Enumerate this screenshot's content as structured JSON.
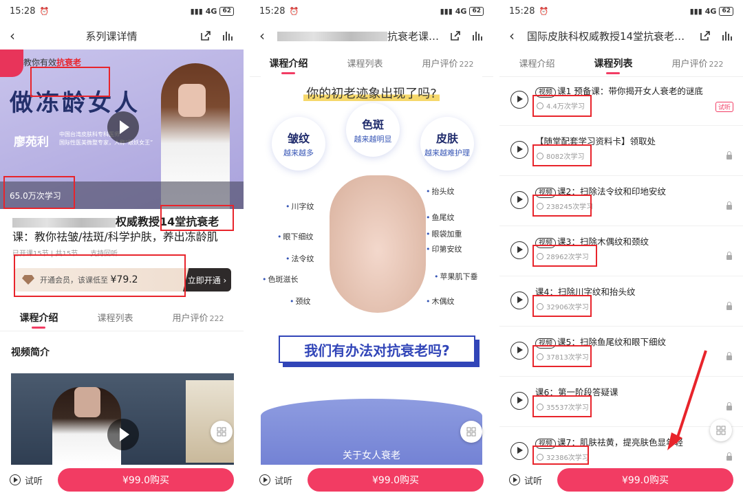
{
  "status": {
    "time": "15:28",
    "network": "4G",
    "battery": "62"
  },
  "panel1": {
    "nav_title": "系列课详情",
    "banner": {
      "tag_prefix": "教你有效",
      "tag_highlight": "抗衰老",
      "big_title": "做冻龄女人",
      "author": "廖苑利",
      "author_desc_1": "中国台湾皮肤科专科医师",
      "author_desc_2": "国际性医美微整专家，人称“眼妖女王”",
      "learn_count": "65.0万次学习"
    },
    "course_title_1": "权威教授14堂抗衰老",
    "course_title_2": "课：教你祛皱/祛斑/科学护肤，养出冻龄肌",
    "meta_lessons": "已开课15节 | 共15节",
    "meta_replay": "支持回听",
    "vip": {
      "text": "开通会员，该课低至",
      "price": "¥79.2",
      "button": "立即开通 ›"
    },
    "tabs": [
      {
        "label": "课程介绍"
      },
      {
        "label": "课程列表"
      },
      {
        "label": "用户评价",
        "count": "222"
      }
    ],
    "section_title": "视频简介",
    "trial_label": "试听",
    "buy_label": "¥99.0购买"
  },
  "panel2": {
    "nav_title": "抗衰老课：...",
    "tabs": [
      {
        "label": "课程介绍"
      },
      {
        "label": "课程列表"
      },
      {
        "label": "用户评价",
        "count": "222"
      }
    ],
    "question_1": "你的初老迹象出现了吗?",
    "bubbles": [
      {
        "title": "皱纹",
        "sub": "越来越多"
      },
      {
        "title": "色斑",
        "sub": "越来越明显"
      },
      {
        "title": "皮肤",
        "sub": "越来越难护理"
      }
    ],
    "face_labels": [
      "抬头纹",
      "川字纹",
      "鱼尾纹",
      "眼袋加重",
      "眼下细纹",
      "印第安纹",
      "法令纹",
      "苹果肌下垂",
      "色斑滋长",
      "颈纹",
      "木偶纹"
    ],
    "question_2": "我们有办法对抗衰老吗?",
    "about": "关于女人衰老",
    "trial_label": "试听",
    "buy_label": "¥99.0购买"
  },
  "panel3": {
    "nav_title": "国际皮肤科权威教授14堂抗衰老课：...",
    "tabs": [
      {
        "label": "课程介绍"
      },
      {
        "label": "课程列表"
      },
      {
        "label": "用户评价",
        "count": "222"
      }
    ],
    "lessons": [
      {
        "badge": "视频",
        "title": "课1 预备课：带你揭开女人衰老的谜底",
        "count": "4.4万次学习",
        "tag": "试听"
      },
      {
        "badge": "",
        "title": "【随堂配套学习资料卡】领取处",
        "count": "8082次学习"
      },
      {
        "badge": "视频",
        "title": "课2：扫除法令纹和印地安纹",
        "count": "238245次学习"
      },
      {
        "badge": "视频",
        "title": "课3：扫除木偶纹和颈纹",
        "count": "28962次学习"
      },
      {
        "badge": "",
        "title": "课4：扫除川字纹和抬头纹",
        "count": "32906次学习"
      },
      {
        "badge": "视频",
        "title": "课5：扫除鱼尾纹和眼下细纹",
        "count": "37813次学习"
      },
      {
        "badge": "",
        "title": "课6：第一阶段答疑课",
        "count": "35537次学习"
      },
      {
        "badge": "视频",
        "title": "课7：肌肤祛黄，提亮肤色显年轻",
        "count": "32386次学习"
      }
    ],
    "trial_label": "试听",
    "buy_label": "¥99.0购买"
  },
  "colors": {
    "accent": "#f23c63",
    "annotation": "#e8242b"
  }
}
